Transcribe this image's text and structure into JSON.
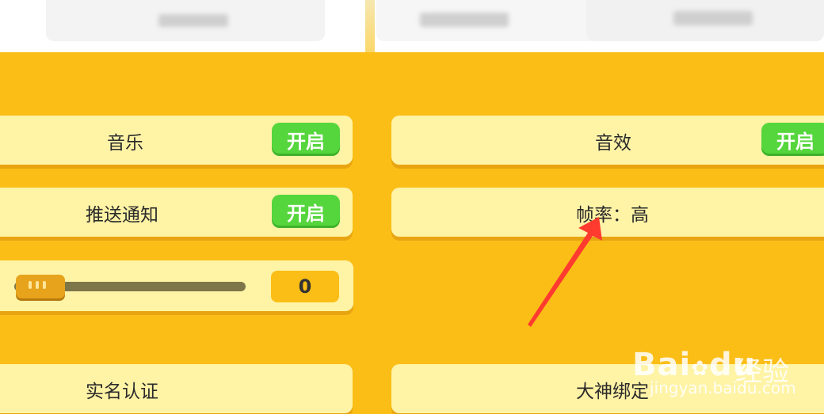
{
  "settings": {
    "music": {
      "label": "音乐",
      "toggle": "开启"
    },
    "sound": {
      "label": "音效",
      "toggle": "开启"
    },
    "push": {
      "label": "推送通知",
      "toggle": "开启"
    },
    "framerate": {
      "label": "帧率：高"
    },
    "slider": {
      "value": "0",
      "level": 0
    },
    "realname": {
      "label": "实名认证"
    },
    "bind": {
      "label": "大神绑定"
    }
  },
  "watermark": {
    "logo": "Bai",
    "logo2": "du",
    "jy": "经验",
    "url": "jingyan.baidu.com"
  },
  "colors": {
    "background": "#FBBE17",
    "row": "#FFF3A6",
    "toggle_on": "#55D63C",
    "arrow": "#FF3B30"
  }
}
